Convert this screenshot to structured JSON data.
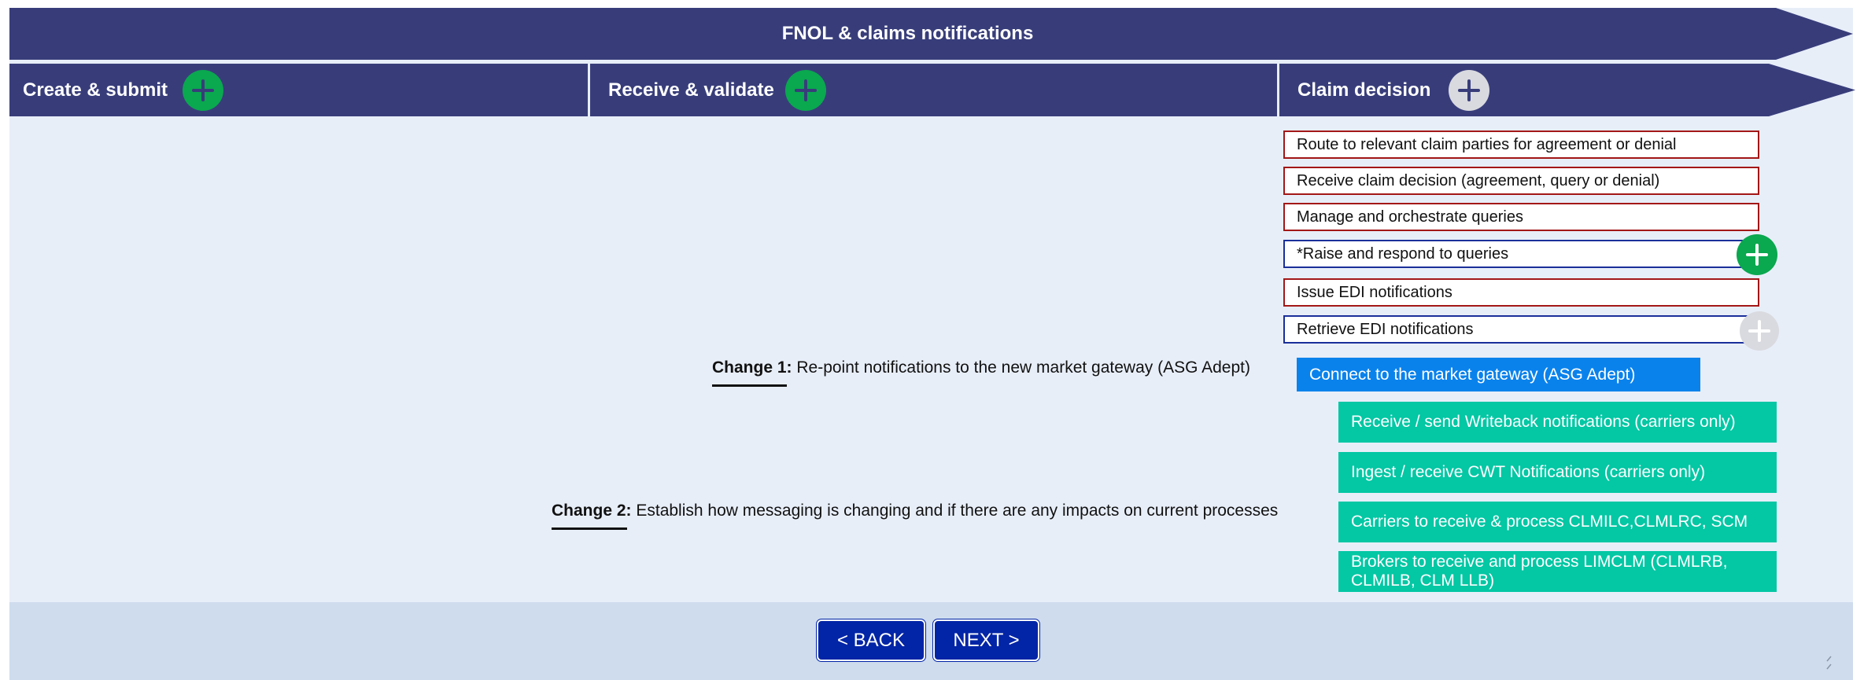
{
  "header": {
    "title": "FNOL & claims notifications"
  },
  "phases": [
    {
      "label": "Create & submit"
    },
    {
      "label": "Receive & validate"
    },
    {
      "label": "Claim decision"
    }
  ],
  "decision_steps": [
    {
      "label": "Route to relevant claim parties for agreement or denial",
      "border": "red"
    },
    {
      "label": "Receive claim decision (agreement, query or denial)",
      "border": "red"
    },
    {
      "label": "Manage and orchestrate queries",
      "border": "red"
    },
    {
      "label": "*Raise and respond to queries",
      "border": "blue"
    },
    {
      "label": "Issue EDI notifications",
      "border": "red"
    },
    {
      "label": "Retrieve EDI notifications",
      "border": "blue"
    }
  ],
  "gateway_box": {
    "label": "Connect to the market gateway (ASG Adept)"
  },
  "messages": [
    {
      "label": "Receive / send Writeback notifications (carriers only)"
    },
    {
      "label": "Ingest / receive CWT Notifications (carriers only)"
    },
    {
      "label": "Carriers to receive & process CLMILC,CLMLRC, SCM"
    },
    {
      "label": "Brokers to receive and process LIMCLM (CLMLRB, CLMILB, CLM LLB)"
    }
  ],
  "changes": [
    {
      "title": "Change 1:",
      "text": "Re-point notifications to the new market gateway (ASG Adept)"
    },
    {
      "title": "Change 2:",
      "text": "Establish how messaging is changing and if there are any impacts on current processes"
    }
  ],
  "nav": {
    "back_label": "< BACK",
    "next_label": "NEXT >"
  },
  "colors": {
    "banner": "#383d7a",
    "background": "#e8eef8",
    "footer": "#cfdcee",
    "plus_active": "#0aa84f",
    "plus_inactive": "#d9dadf",
    "border_red": "#a31717",
    "border_blue": "#1a2f9a",
    "gateway": "#0a82ec",
    "teal": "#04c7a4",
    "button": "#0224a6"
  },
  "icons": {
    "expand": "plus-icon"
  }
}
